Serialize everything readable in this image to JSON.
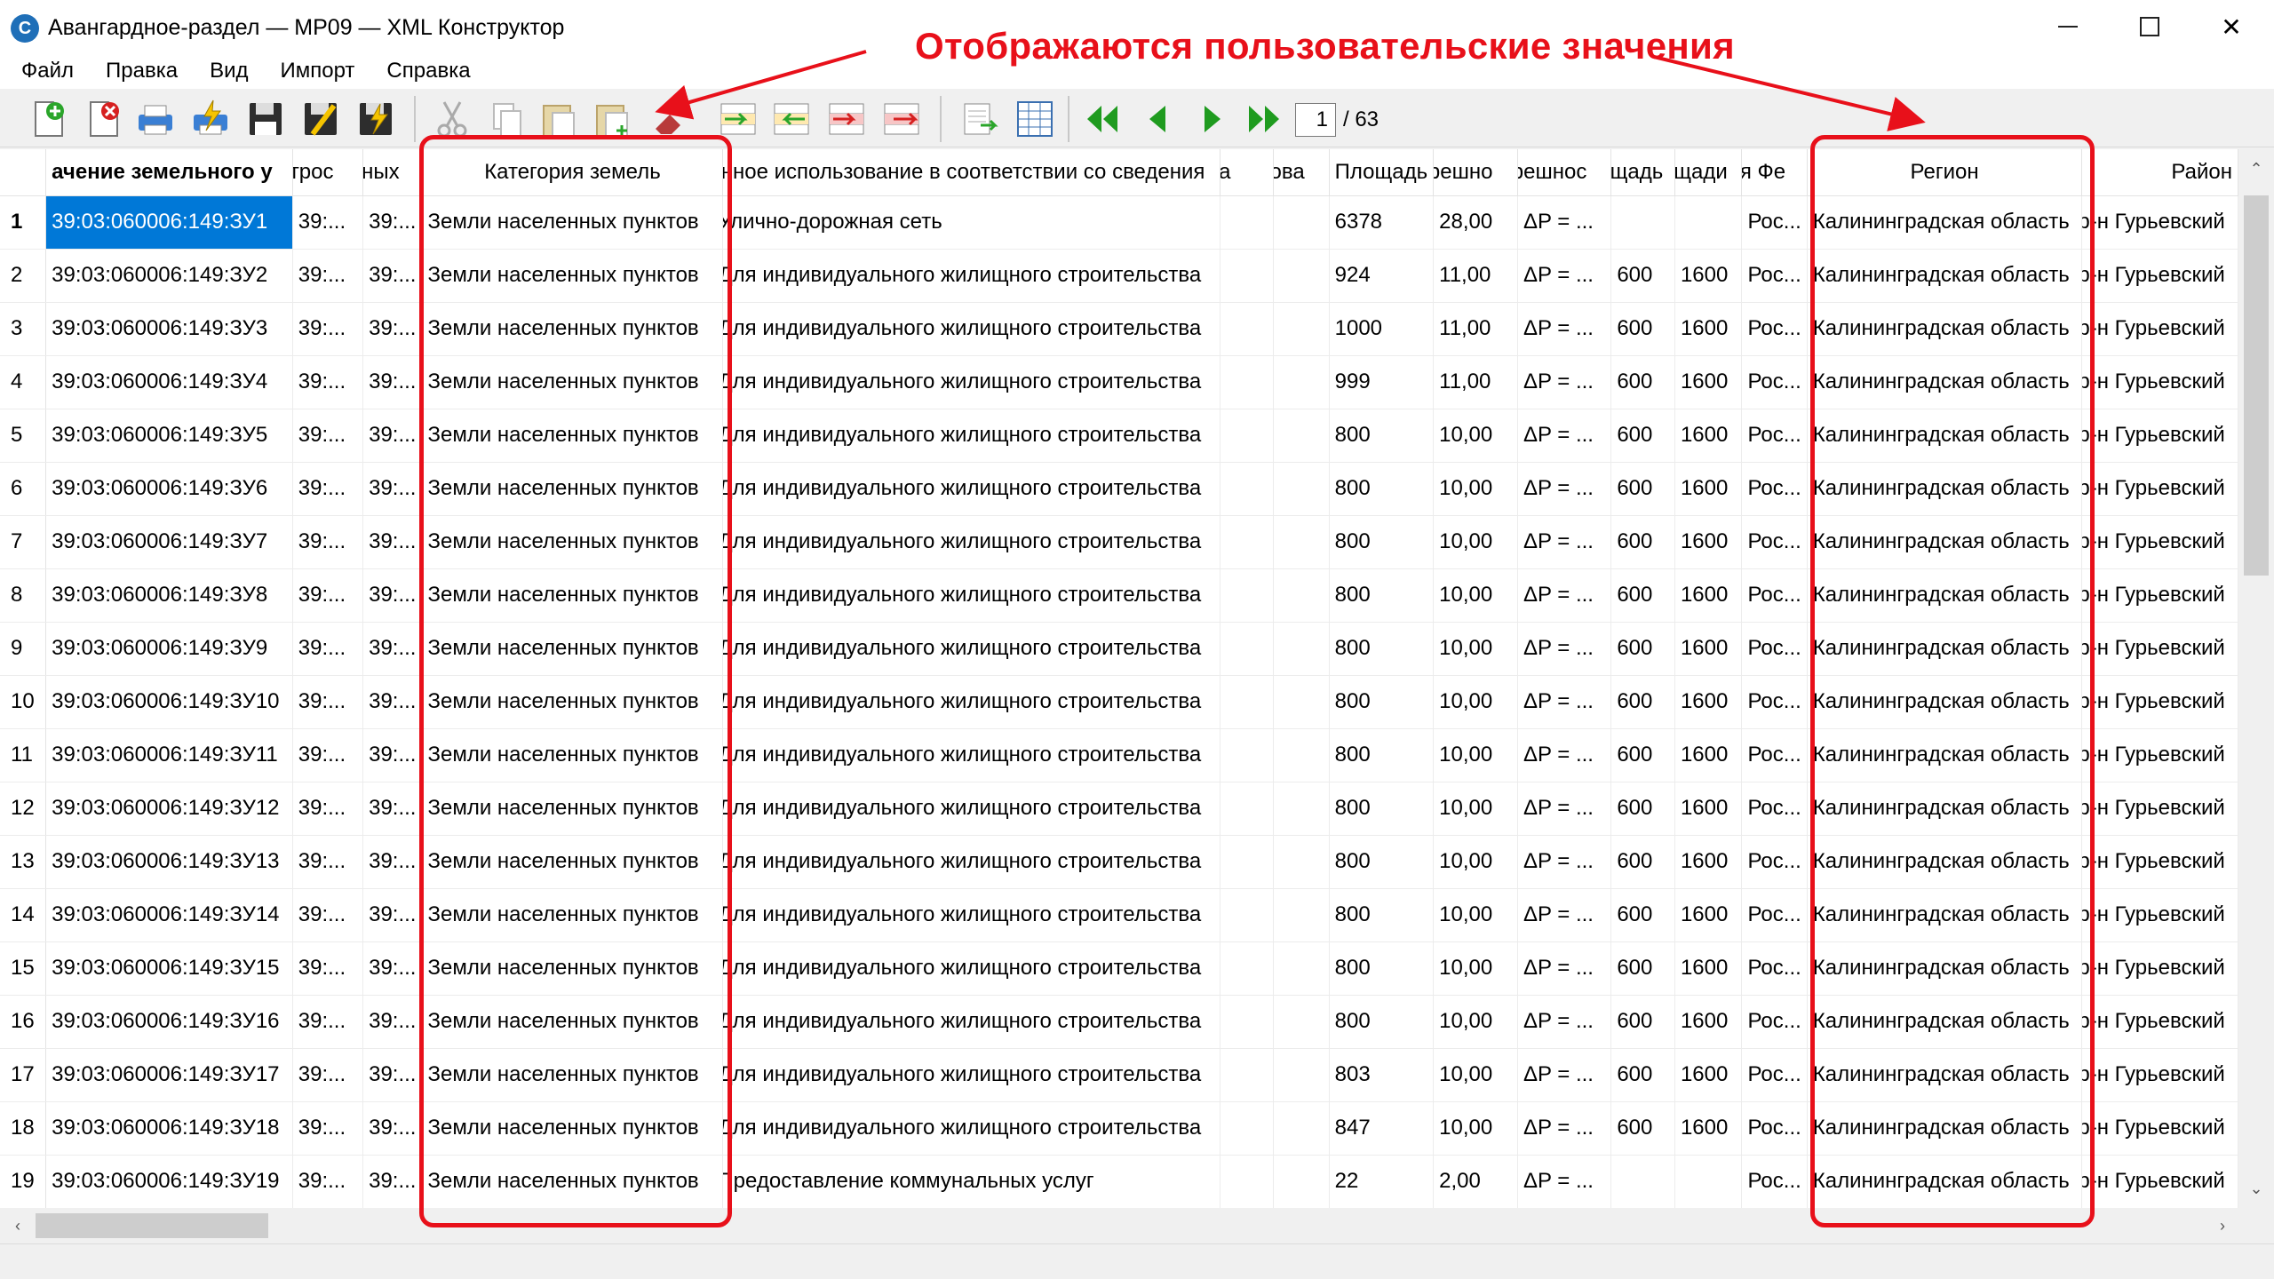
{
  "window": {
    "title": "Авангардное-раздел — МР09 — XML Конструктор",
    "logo_letter": "C",
    "min_glyph": "",
    "close_glyph": "✕"
  },
  "menu": [
    "Файл",
    "Правка",
    "Вид",
    "Импорт",
    "Справка"
  ],
  "pager": {
    "current": "1",
    "total": "/ 63"
  },
  "annotation": {
    "text": "Отображаются пользовательские значения",
    "color": "#e8101a"
  },
  "colors": {
    "selection": "#0078d7",
    "accent": "#e8101a"
  },
  "toolbar_icons": [
    "new-doc-icon",
    "delete-doc-icon",
    "print-icon",
    "quick-print-icon",
    "save-icon",
    "save-as-icon",
    "save-all-icon",
    "cut-icon",
    "copy-icon",
    "paste-icon",
    "paste-new-icon",
    "erase-icon",
    "insert-row-icon",
    "insert-row-above-icon",
    "delete-row-icon",
    "delete-rows-icon",
    "export-icon",
    "table-icon",
    "first-page-icon",
    "prev-page-icon",
    "next-page-icon",
    "last-page-icon"
  ],
  "table": {
    "headers": [
      "",
      "ачение земельного у",
      "строс",
      "дных",
      "Категория земель",
      "енное использование в соответствии со сведения",
      "на",
      "зова",
      "Площадь",
      "грешно",
      "грешнос",
      "ощадь",
      "ощади",
      "ая Фе",
      "Регион",
      "Район"
    ],
    "rows": [
      [
        "1",
        "39:03:060006:149:ЗУ1",
        "39:...",
        "39:...",
        "Земли населенных пунктов",
        "Улично-дорожная сеть",
        "",
        "",
        "6378",
        "28,00",
        "ΔP = ...",
        "",
        "",
        "Рос...",
        "Калининградская область",
        "р-н Гурьевский"
      ],
      [
        "2",
        "39:03:060006:149:ЗУ2",
        "39:...",
        "39:...",
        "Земли населенных пунктов",
        "Для индивидуального жилищного строительства",
        "",
        "",
        "924",
        "11,00",
        "ΔP = ...",
        "600",
        "1600",
        "Рос...",
        "Калининградская область",
        "р-н Гурьевский"
      ],
      [
        "3",
        "39:03:060006:149:ЗУ3",
        "39:...",
        "39:...",
        "Земли населенных пунктов",
        "Для индивидуального жилищного строительства",
        "",
        "",
        "1000",
        "11,00",
        "ΔP = ...",
        "600",
        "1600",
        "Рос...",
        "Калининградская область",
        "р-н Гурьевский"
      ],
      [
        "4",
        "39:03:060006:149:ЗУ4",
        "39:...",
        "39:...",
        "Земли населенных пунктов",
        "Для индивидуального жилищного строительства",
        "",
        "",
        "999",
        "11,00",
        "ΔP = ...",
        "600",
        "1600",
        "Рос...",
        "Калининградская область",
        "р-н Гурьевский"
      ],
      [
        "5",
        "39:03:060006:149:ЗУ5",
        "39:...",
        "39:...",
        "Земли населенных пунктов",
        "Для индивидуального жилищного строительства",
        "",
        "",
        "800",
        "10,00",
        "ΔP = ...",
        "600",
        "1600",
        "Рос...",
        "Калининградская область",
        "р-н Гурьевский"
      ],
      [
        "6",
        "39:03:060006:149:ЗУ6",
        "39:...",
        "39:...",
        "Земли населенных пунктов",
        "Для индивидуального жилищного строительства",
        "",
        "",
        "800",
        "10,00",
        "ΔP = ...",
        "600",
        "1600",
        "Рос...",
        "Калининградская область",
        "р-н Гурьевский"
      ],
      [
        "7",
        "39:03:060006:149:ЗУ7",
        "39:...",
        "39:...",
        "Земли населенных пунктов",
        "Для индивидуального жилищного строительства",
        "",
        "",
        "800",
        "10,00",
        "ΔP = ...",
        "600",
        "1600",
        "Рос...",
        "Калининградская область",
        "р-н Гурьевский"
      ],
      [
        "8",
        "39:03:060006:149:ЗУ8",
        "39:...",
        "39:...",
        "Земли населенных пунктов",
        "Для индивидуального жилищного строительства",
        "",
        "",
        "800",
        "10,00",
        "ΔP = ...",
        "600",
        "1600",
        "Рос...",
        "Калининградская область",
        "р-н Гурьевский"
      ],
      [
        "9",
        "39:03:060006:149:ЗУ9",
        "39:...",
        "39:...",
        "Земли населенных пунктов",
        "Для индивидуального жилищного строительства",
        "",
        "",
        "800",
        "10,00",
        "ΔP = ...",
        "600",
        "1600",
        "Рос...",
        "Калининградская область",
        "р-н Гурьевский"
      ],
      [
        "10",
        "39:03:060006:149:ЗУ10",
        "39:...",
        "39:...",
        "Земли населенных пунктов",
        "Для индивидуального жилищного строительства",
        "",
        "",
        "800",
        "10,00",
        "ΔP = ...",
        "600",
        "1600",
        "Рос...",
        "Калининградская область",
        "р-н Гурьевский"
      ],
      [
        "11",
        "39:03:060006:149:ЗУ11",
        "39:...",
        "39:...",
        "Земли населенных пунктов",
        "Для индивидуального жилищного строительства",
        "",
        "",
        "800",
        "10,00",
        "ΔP = ...",
        "600",
        "1600",
        "Рос...",
        "Калининградская область",
        "р-н Гурьевский"
      ],
      [
        "12",
        "39:03:060006:149:ЗУ12",
        "39:...",
        "39:...",
        "Земли населенных пунктов",
        "Для индивидуального жилищного строительства",
        "",
        "",
        "800",
        "10,00",
        "ΔP = ...",
        "600",
        "1600",
        "Рос...",
        "Калининградская область",
        "р-н Гурьевский"
      ],
      [
        "13",
        "39:03:060006:149:ЗУ13",
        "39:...",
        "39:...",
        "Земли населенных пунктов",
        "Для индивидуального жилищного строительства",
        "",
        "",
        "800",
        "10,00",
        "ΔP = ...",
        "600",
        "1600",
        "Рос...",
        "Калининградская область",
        "р-н Гурьевский"
      ],
      [
        "14",
        "39:03:060006:149:ЗУ14",
        "39:...",
        "39:...",
        "Земли населенных пунктов",
        "Для индивидуального жилищного строительства",
        "",
        "",
        "800",
        "10,00",
        "ΔP = ...",
        "600",
        "1600",
        "Рос...",
        "Калининградская область",
        "р-н Гурьевский"
      ],
      [
        "15",
        "39:03:060006:149:ЗУ15",
        "39:...",
        "39:...",
        "Земли населенных пунктов",
        "Для индивидуального жилищного строительства",
        "",
        "",
        "800",
        "10,00",
        "ΔP = ...",
        "600",
        "1600",
        "Рос...",
        "Калининградская область",
        "р-н Гурьевский"
      ],
      [
        "16",
        "39:03:060006:149:ЗУ16",
        "39:...",
        "39:...",
        "Земли населенных пунктов",
        "Для индивидуального жилищного строительства",
        "",
        "",
        "800",
        "10,00",
        "ΔP = ...",
        "600",
        "1600",
        "Рос...",
        "Калининградская область",
        "р-н Гурьевский"
      ],
      [
        "17",
        "39:03:060006:149:ЗУ17",
        "39:...",
        "39:...",
        "Земли населенных пунктов",
        "Для индивидуального жилищного строительства",
        "",
        "",
        "803",
        "10,00",
        "ΔP = ...",
        "600",
        "1600",
        "Рос...",
        "Калининградская область",
        "р-н Гурьевский"
      ],
      [
        "18",
        "39:03:060006:149:ЗУ18",
        "39:...",
        "39:...",
        "Земли населенных пунктов",
        "Для индивидуального жилищного строительства",
        "",
        "",
        "847",
        "10,00",
        "ΔP = ...",
        "600",
        "1600",
        "Рос...",
        "Калининградская область",
        "р-н Гурьевский"
      ],
      [
        "19",
        "39:03:060006:149:ЗУ19",
        "39:...",
        "39:...",
        "Земли населенных пунктов",
        "Предоставление коммунальных услуг",
        "",
        "",
        "22",
        "2,00",
        "ΔP = ...",
        "",
        "",
        "Рос...",
        "Калининградская область",
        "р-н Гурьевский"
      ]
    ]
  }
}
